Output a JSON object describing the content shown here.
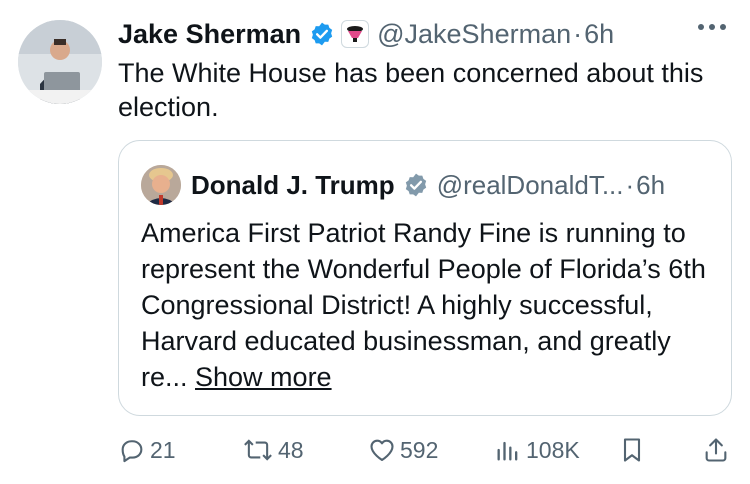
{
  "tweet": {
    "author_name": "Jake Sherman",
    "handle": "@JakeSherman",
    "separator": "·",
    "time": "6h",
    "text": "The White House has been concerned about this election."
  },
  "quote": {
    "author_name": "Donald J. Trump",
    "handle": "@realDonaldT...",
    "separator": "·",
    "time": "6h",
    "text": "America First Patriot Randy Fine is running to represent the Wonderful People of Florida’s 6th Congressional District! A highly successful, Harvard educated businessman, and greatly re... ",
    "show_more": "Show more"
  },
  "actions": {
    "replies": "21",
    "reposts": "48",
    "likes": "592",
    "views": "108K"
  },
  "icons": {
    "verified_color": "#1d9bf0",
    "quote_verified_color": "#829aab",
    "icon_color": "#536471"
  }
}
